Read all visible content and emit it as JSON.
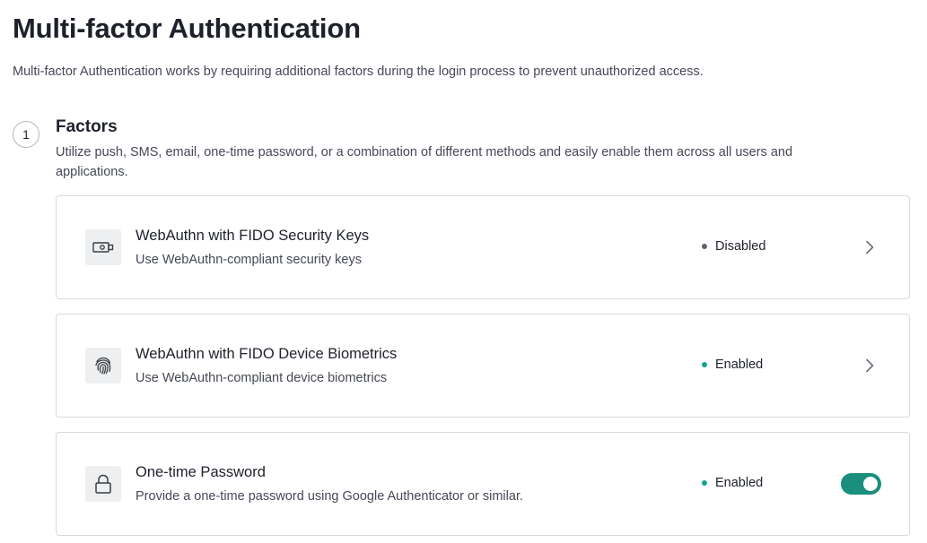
{
  "page": {
    "title": "Multi-factor Authentication",
    "description": "Multi-factor Authentication works by requiring additional factors during the login process to prevent unauthorized access."
  },
  "section": {
    "step_number": "1",
    "title": "Factors",
    "description": "Utilize push, SMS, email, one-time password, or a combination of different methods and easily enable them across all users and applications."
  },
  "colors": {
    "enabled": "#12a58f",
    "disabled": "#5f6370",
    "toggle_on": "#1a8f7d"
  },
  "factors": [
    {
      "icon": "security-key-icon",
      "title": "WebAuthn with FIDO Security Keys",
      "subtitle": "Use WebAuthn-compliant security keys",
      "status": "Disabled",
      "action": "chevron-right-icon"
    },
    {
      "icon": "fingerprint-icon",
      "title": "WebAuthn with FIDO Device Biometrics",
      "subtitle": "Use WebAuthn-compliant device biometrics",
      "status": "Enabled",
      "action": "chevron-right-icon"
    },
    {
      "icon": "lock-icon",
      "title": "One-time Password",
      "subtitle": "Provide a one-time password using Google Authenticator or similar.",
      "status": "Enabled",
      "action": "toggle",
      "toggle_on": true
    }
  ]
}
